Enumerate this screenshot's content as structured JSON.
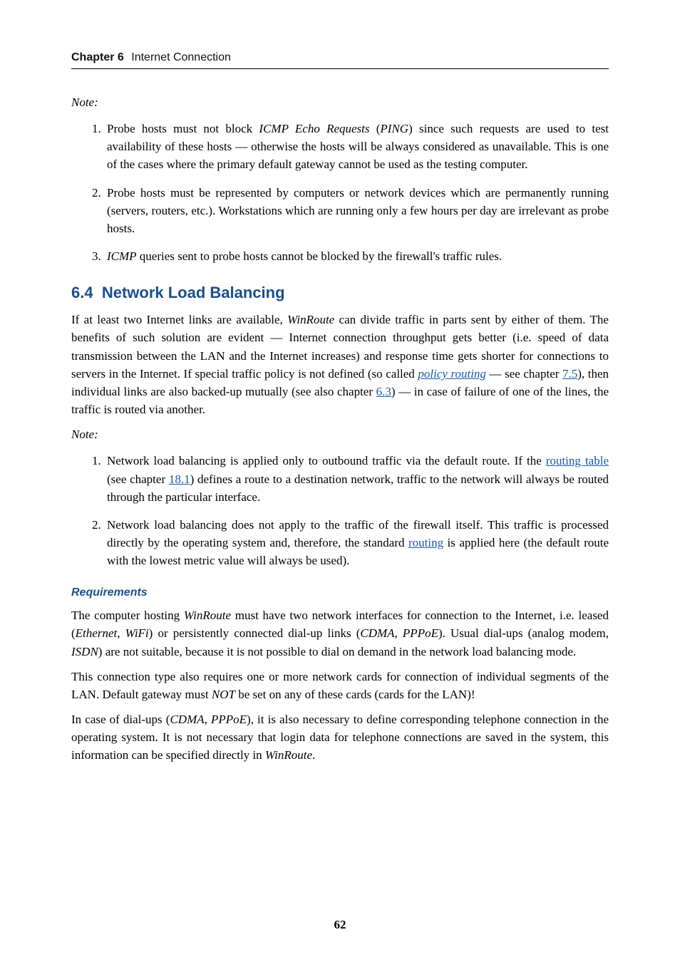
{
  "running_head": {
    "chapter_label": "Chapter 6",
    "chapter_title": "Internet Connection"
  },
  "noteA_label": "Note:",
  "noteA": {
    "item1": {
      "pre": "Probe hosts must not block ",
      "em1": "ICMP Echo Requests",
      "mid1": " (",
      "em2": "PING",
      "post": ") since such requests are used to test availability of these hosts — otherwise the hosts will be always considered as unavailable. This is one of the cases where the primary default gateway cannot be used as the testing computer."
    },
    "item2": "Probe hosts must be represented by computers or network devices which are permanently running (servers, routers, etc.). Workstations which are running only a few hours per day are irrelevant as probe hosts.",
    "item3": {
      "em": "ICMP",
      "post": " queries sent to probe hosts cannot be blocked by the firewall's traffic rules."
    }
  },
  "section": {
    "number": "6.4",
    "title": "Network Load Balancing"
  },
  "para1": {
    "pre": "If at least two Internet links are available, ",
    "em1": "WinRoute",
    "mid1": " can divide traffic in parts sent by either of them. The benefits of such solution are evident — Internet connection throughput gets better (i.e. speed of data transmission between the LAN and the Internet increases) and response time gets shorter for connections to servers in the Internet. If special traffic policy is not defined (so called ",
    "link1": "policy routing",
    "mid2": " — see chapter ",
    "link2": "7.5",
    "mid3": "), then individual links are also backed-up mutually (see also chapter ",
    "link3": "6.3",
    "post": ") — in case of failure of one of the lines, the traffic is routed via another."
  },
  "noteB_label": "Note:",
  "noteB": {
    "item1": {
      "pre": "Network load balancing is applied only to outbound traffic via the default route. If the ",
      "link1": "routing table",
      "mid": " (see chapter ",
      "link2": "18.1",
      "post": ") defines a route to a destination network, traffic to the network will always be routed through the particular interface."
    },
    "item2": {
      "pre": "Network load balancing does not apply to the traffic of the firewall itself. This traffic is processed directly by the operating system and, therefore, the standard ",
      "link": "routing",
      "post": " is applied here (the default route with the lowest metric value will always be used)."
    }
  },
  "req_heading": "Requirements",
  "req_p1": {
    "pre": "The computer hosting ",
    "em1": "WinRoute",
    "mid1": " must have two network interfaces for connection to the Internet, i.e. leased (",
    "em2": "Ethernet",
    "sep1": ", ",
    "em3": "WiFi",
    "mid2": ") or persistently connected dial-up links (",
    "em4": "CDMA",
    "sep2": ", ",
    "em5": "PPPoE",
    "mid3": "). Usual dial-ups (analog modem, ",
    "em6": "ISDN",
    "post": ") are not suitable, because it is not possible to dial on demand in the network load balancing mode."
  },
  "req_p2": {
    "pre": "This connection type also requires one or more network cards for connection of individual segments of the LAN. Default gateway must ",
    "em": "NOT",
    "post": " be set on any of these cards (cards for the LAN)!"
  },
  "req_p3": {
    "pre": "In case of dial-ups (",
    "em1": "CDMA",
    "sep": ", ",
    "em2": "PPPoE",
    "mid": "), it is also necessary to define corresponding telephone connection in the operating system. It is not necessary that login data for telephone connections are saved in the system, this information can be specified directly in ",
    "em3": "WinRoute",
    "post": "."
  },
  "page_number": "62"
}
